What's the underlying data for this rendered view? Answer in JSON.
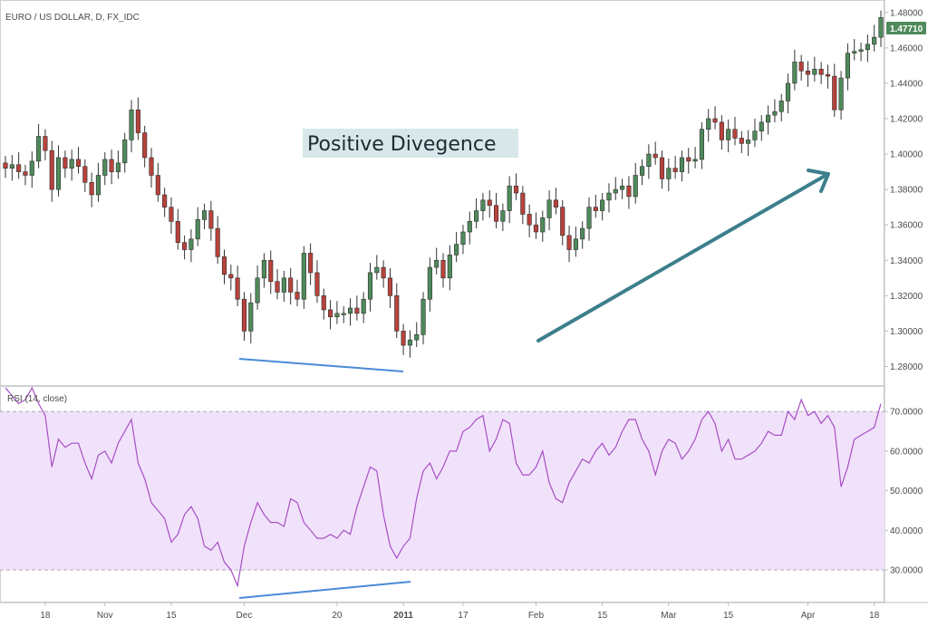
{
  "chart_title": "EURO / US DOLLAR, D, FX_IDC",
  "annotation": "Positive Divegence",
  "last_price_label": "1.47710",
  "rsi_label": "RSI (14, close)",
  "colors": {
    "up": "#4f8a5b",
    "down": "#b8423c",
    "wick": "#333333",
    "rsi_line": "#a64fc4",
    "rsi_band": "#f1e2fb",
    "divergence_line": "#4a8ad8",
    "trend_arrow": "#3c7f8c",
    "annotation_bg": "#d8e8ea",
    "badge": "#4f8a5b"
  },
  "chart_data": [
    {
      "type": "candlestick",
      "series": "EURO / US DOLLAR, D, FX_IDC",
      "ylim": [
        1.27,
        1.485
      ],
      "y_ticks": [
        "1.28000",
        "1.30000",
        "1.32000",
        "1.34000",
        "1.36000",
        "1.38000",
        "1.40000",
        "1.42000",
        "1.44000",
        "1.46000",
        "1.48000"
      ],
      "y_tick_values": [
        1.28,
        1.3,
        1.32,
        1.34,
        1.36,
        1.38,
        1.4,
        1.42,
        1.44,
        1.46,
        1.48
      ],
      "last_value": 1.4771,
      "closes": [
        1.392,
        1.394,
        1.39,
        1.388,
        1.396,
        1.41,
        1.402,
        1.38,
        1.398,
        1.392,
        1.397,
        1.393,
        1.384,
        1.377,
        1.388,
        1.397,
        1.39,
        1.395,
        1.408,
        1.425,
        1.412,
        1.398,
        1.388,
        1.377,
        1.37,
        1.362,
        1.35,
        1.346,
        1.352,
        1.363,
        1.368,
        1.358,
        1.342,
        1.332,
        1.33,
        1.318,
        1.3,
        1.316,
        1.33,
        1.34,
        1.328,
        1.322,
        1.33,
        1.322,
        1.318,
        1.344,
        1.333,
        1.32,
        1.312,
        1.308,
        1.31,
        1.31,
        1.313,
        1.31,
        1.318,
        1.333,
        1.336,
        1.33,
        1.32,
        1.3,
        1.292,
        1.295,
        1.298,
        1.318,
        1.336,
        1.34,
        1.33,
        1.343,
        1.349,
        1.356,
        1.362,
        1.368,
        1.374,
        1.371,
        1.362,
        1.368,
        1.382,
        1.378,
        1.366,
        1.36,
        1.356,
        1.364,
        1.374,
        1.37,
        1.354,
        1.346,
        1.352,
        1.358,
        1.37,
        1.368,
        1.374,
        1.378,
        1.38,
        1.382,
        1.376,
        1.388,
        1.393,
        1.4,
        1.398,
        1.386,
        1.392,
        1.39,
        1.398,
        1.396,
        1.397,
        1.414,
        1.42,
        1.418,
        1.408,
        1.414,
        1.409,
        1.406,
        1.408,
        1.413,
        1.418,
        1.422,
        1.424,
        1.43,
        1.44,
        1.452,
        1.447,
        1.445,
        1.448,
        1.445,
        1.444,
        1.425,
        1.443,
        1.457,
        1.458,
        1.459,
        1.462,
        1.466,
        1.4771
      ],
      "opens": [
        1.395,
        1.392,
        1.394,
        1.39,
        1.388,
        1.396,
        1.41,
        1.402,
        1.38,
        1.398,
        1.392,
        1.397,
        1.393,
        1.384,
        1.377,
        1.388,
        1.397,
        1.39,
        1.395,
        1.408,
        1.425,
        1.412,
        1.398,
        1.388,
        1.377,
        1.37,
        1.362,
        1.35,
        1.346,
        1.352,
        1.363,
        1.368,
        1.358,
        1.342,
        1.332,
        1.33,
        1.318,
        1.3,
        1.316,
        1.33,
        1.34,
        1.328,
        1.322,
        1.33,
        1.322,
        1.318,
        1.344,
        1.333,
        1.32,
        1.312,
        1.308,
        1.31,
        1.31,
        1.313,
        1.31,
        1.318,
        1.333,
        1.336,
        1.33,
        1.32,
        1.3,
        1.292,
        1.295,
        1.298,
        1.318,
        1.336,
        1.34,
        1.33,
        1.343,
        1.349,
        1.356,
        1.362,
        1.368,
        1.374,
        1.371,
        1.362,
        1.368,
        1.382,
        1.378,
        1.366,
        1.36,
        1.356,
        1.364,
        1.374,
        1.37,
        1.354,
        1.346,
        1.352,
        1.358,
        1.37,
        1.368,
        1.374,
        1.378,
        1.38,
        1.382,
        1.376,
        1.388,
        1.393,
        1.4,
        1.398,
        1.386,
        1.392,
        1.39,
        1.398,
        1.396,
        1.397,
        1.414,
        1.42,
        1.418,
        1.408,
        1.414,
        1.409,
        1.406,
        1.408,
        1.413,
        1.418,
        1.422,
        1.424,
        1.43,
        1.44,
        1.452,
        1.447,
        1.445,
        1.448,
        1.445,
        1.444,
        1.425,
        1.443,
        1.457,
        1.458,
        1.459,
        1.462,
        1.466
      ]
    },
    {
      "type": "line",
      "series": "RSI (14, close)",
      "ylim": [
        22,
        76
      ],
      "y_ticks": [
        "30.0000",
        "40.0000",
        "50.0000",
        "60.0000",
        "70.0000"
      ],
      "y_tick_values": [
        30,
        40,
        50,
        60,
        70
      ],
      "band": [
        30,
        70
      ],
      "values": [
        76,
        74,
        72,
        73,
        76,
        72,
        69,
        56,
        63,
        61,
        62,
        62,
        57,
        53,
        59,
        60,
        57,
        62,
        65,
        68,
        57,
        53,
        47,
        45,
        43,
        37,
        39,
        44,
        46,
        43,
        36,
        35,
        37,
        32,
        30,
        26,
        36,
        42,
        47,
        44,
        42,
        42,
        41,
        48,
        47,
        42,
        40,
        38,
        38,
        39,
        38,
        40,
        39,
        46,
        51,
        56,
        55,
        44,
        36,
        33,
        36,
        38,
        48,
        55,
        57,
        53,
        56,
        60,
        60,
        65,
        66,
        68,
        69,
        60,
        63,
        68,
        67,
        57,
        54,
        54,
        56,
        60,
        52,
        48,
        47,
        52,
        55,
        58,
        57,
        60,
        62,
        59,
        61,
        65,
        68,
        68,
        63,
        60,
        54,
        60,
        63,
        62,
        58,
        60,
        63,
        68,
        70,
        67,
        60,
        63,
        58,
        58,
        59,
        60,
        62,
        65,
        64,
        64,
        70,
        68,
        73,
        69,
        70,
        67,
        69,
        66,
        51,
        56,
        63,
        64,
        65,
        66,
        72
      ]
    }
  ],
  "x_axis": {
    "labels": [
      {
        "text": "18",
        "i": 6
      },
      {
        "text": "Nov",
        "i": 15
      },
      {
        "text": "15",
        "i": 25
      },
      {
        "text": "Dec",
        "i": 36
      },
      {
        "text": "20",
        "i": 50
      },
      {
        "text": "2011",
        "i": 60,
        "bold": true
      },
      {
        "text": "17",
        "i": 69
      },
      {
        "text": "Feb",
        "i": 80
      },
      {
        "text": "15",
        "i": 90
      },
      {
        "text": "Mar",
        "i": 100
      },
      {
        "text": "15",
        "i": 109
      },
      {
        "text": "Apr",
        "i": 121
      },
      {
        "text": "18",
        "i": 131
      }
    ]
  }
}
